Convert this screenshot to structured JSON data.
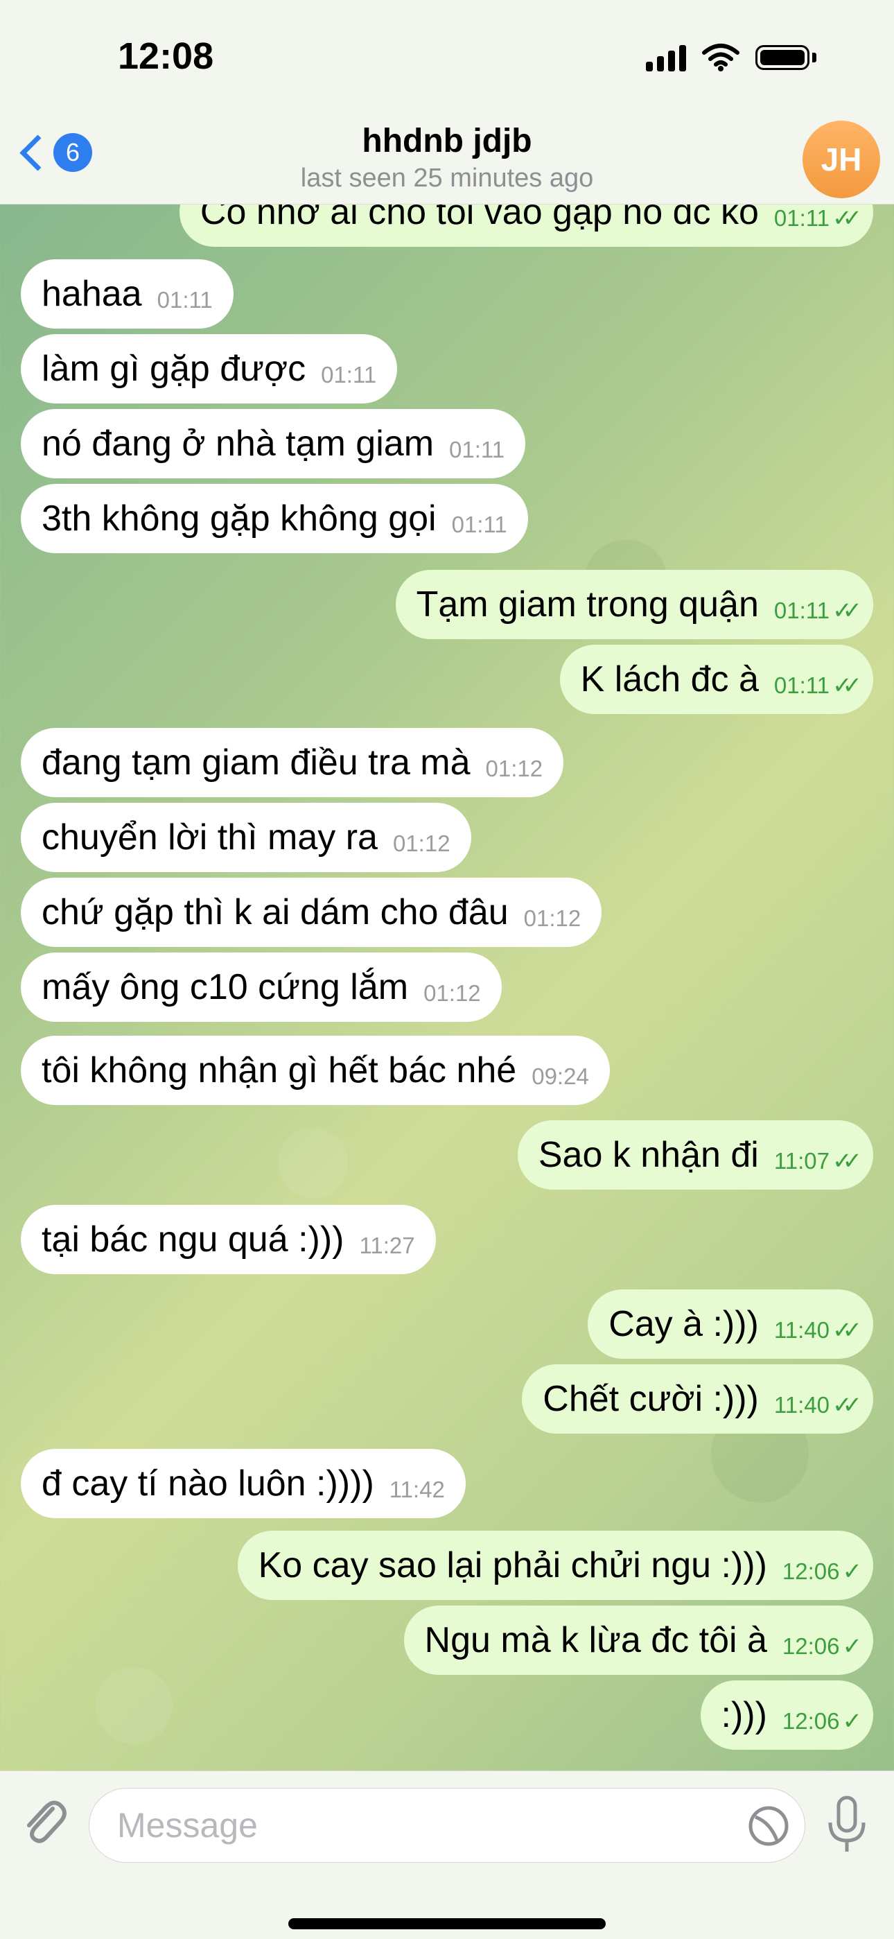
{
  "status_bar": {
    "time": "12:08"
  },
  "header": {
    "back_count": "6",
    "contact_name": "hhdnb jdjb",
    "last_seen": "last seen 25 minutes ago",
    "avatar_initials": "JH"
  },
  "messages": [
    {
      "dir": "out",
      "text": "Có nhờ ai cho tôi vào gặp nó đc ko",
      "time": "01:11",
      "read": true
    },
    {
      "dir": "in",
      "text": "hahaa",
      "time": "01:11"
    },
    {
      "dir": "in",
      "text": "làm gì gặp được",
      "time": "01:11"
    },
    {
      "dir": "in",
      "text": "nó đang ở nhà tạm giam",
      "time": "01:11"
    },
    {
      "dir": "in",
      "text": "3th không gặp không gọi",
      "time": "01:11"
    },
    {
      "dir": "out",
      "text": "Tạm giam trong quận",
      "time": "01:11",
      "read": true
    },
    {
      "dir": "out",
      "text": "K lách đc à",
      "time": "01:11",
      "read": true
    },
    {
      "dir": "in",
      "text": "đang tạm giam điều tra mà",
      "time": "01:12"
    },
    {
      "dir": "in",
      "text": "chuyển lời thì may ra",
      "time": "01:12"
    },
    {
      "dir": "in",
      "text": "chứ gặp thì k ai dám cho đâu",
      "time": "01:12"
    },
    {
      "dir": "in",
      "text": "mấy ông c10 cứng lắm",
      "time": "01:12"
    },
    {
      "dir": "in",
      "text": "tôi không nhận gì hết bác nhé",
      "time": "09:24"
    },
    {
      "dir": "out",
      "text": "Sao k nhận đi",
      "time": "11:07",
      "read": true
    },
    {
      "dir": "in",
      "text": "tại bác ngu quá :)))",
      "time": "11:27"
    },
    {
      "dir": "out",
      "text": "Cay à :)))",
      "time": "11:40",
      "read": true
    },
    {
      "dir": "out",
      "text": "Chết cười :)))",
      "time": "11:40",
      "read": true
    },
    {
      "dir": "in",
      "text": "đ cay tí nào luôn :))))",
      "time": "11:42"
    },
    {
      "dir": "out",
      "text": "Ko cay sao lại phải chửi ngu :)))",
      "time": "12:06",
      "read": false
    },
    {
      "dir": "out",
      "text": "Ngu mà k lừa đc tôi à",
      "time": "12:06",
      "read": false
    },
    {
      "dir": "out",
      "text": ":)))",
      "time": "12:06",
      "read": false
    }
  ],
  "input_bar": {
    "placeholder": "Message"
  },
  "colors": {
    "accent": "#2f7ef0",
    "outgoing_bubble": "#e7fbd3",
    "incoming_bubble": "#ffffff",
    "check": "#3b9e3f",
    "avatar": "#f39a3f"
  }
}
